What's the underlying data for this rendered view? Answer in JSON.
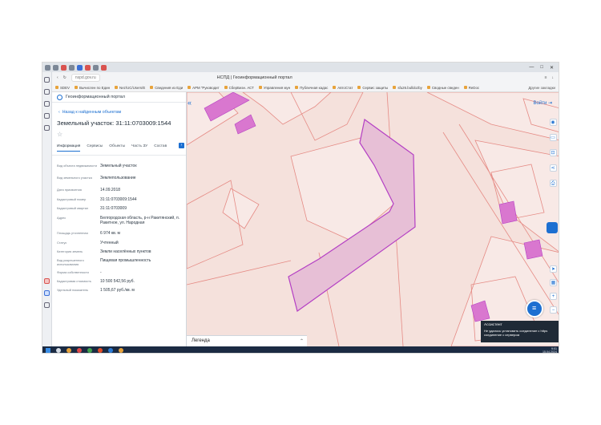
{
  "browser": {
    "address": "nspd.gov.ru",
    "page_title": "НСПД | Геоинформационный портал",
    "bookmarks": [
      "SDEV",
      "Вычислен по Един",
      "Nez/UC/Users/E",
      "Сведения из Еди",
      "АРМ \"Руководит",
      "СберБизн. АСТ",
      "Управления мун",
      "Публичная кадас",
      "АвтоСтат",
      "Сервис защиты",
      "sfu26.bulldozby",
      "Сводные сведен",
      "ReDoc",
      "Другие закладки"
    ]
  },
  "portal": {
    "name": "Геоинформационный портал",
    "login": "Войти"
  },
  "panel": {
    "back_link": "Назад к найденным объектам",
    "title": "Земельный участок: 31:11:0703009:1544",
    "tabs": [
      "Информация",
      "Сервисы",
      "Объекты",
      "Часть ЗУ",
      "Состав"
    ],
    "rows": [
      {
        "k": "Вид объекта недвижимости",
        "v": "Земельный участок"
      },
      {
        "k": "Вид земельного участка",
        "v": "Землепользование"
      },
      {
        "k": "Дата присвоения",
        "v": "14.09.2018"
      },
      {
        "k": "Кадастровый номер",
        "v": "31:11:0703009:1544"
      },
      {
        "k": "Кадастровый квартал",
        "v": "31:11:0703009"
      },
      {
        "k": "Адрес",
        "v": "Белгородская область, р-н Ракитянский, п. Ракитное, ул. Народная"
      },
      {
        "k": "Площадь уточненная",
        "v": "6 974 кв. м"
      },
      {
        "k": "Статус",
        "v": "Учтенный"
      },
      {
        "k": "Категория земель",
        "v": "Земли населённых пунктов"
      },
      {
        "k": "Вид разрешенного использования",
        "v": "Пищевая промышленность"
      },
      {
        "k": "Форма собственности",
        "v": "-"
      },
      {
        "k": "Кадастровая стоимость",
        "v": "10 500 542,56 руб."
      },
      {
        "k": "Удельный показатель",
        "v": "1 505,67 руб./кв. м"
      }
    ]
  },
  "map": {
    "legend_label": "Легенда",
    "colors": {
      "background": "#f5e1dc",
      "parcel_fill": "#e7bfd6",
      "parcel_stroke": "#b43fc4",
      "building": "#d977cf",
      "outline": "#e58a84"
    }
  },
  "toast": {
    "title": "Ассистент",
    "text": "Не удалось установить соединение с https соединение с сервером"
  },
  "taskbar": {
    "time": "9:01",
    "date": "15.04.2024"
  }
}
